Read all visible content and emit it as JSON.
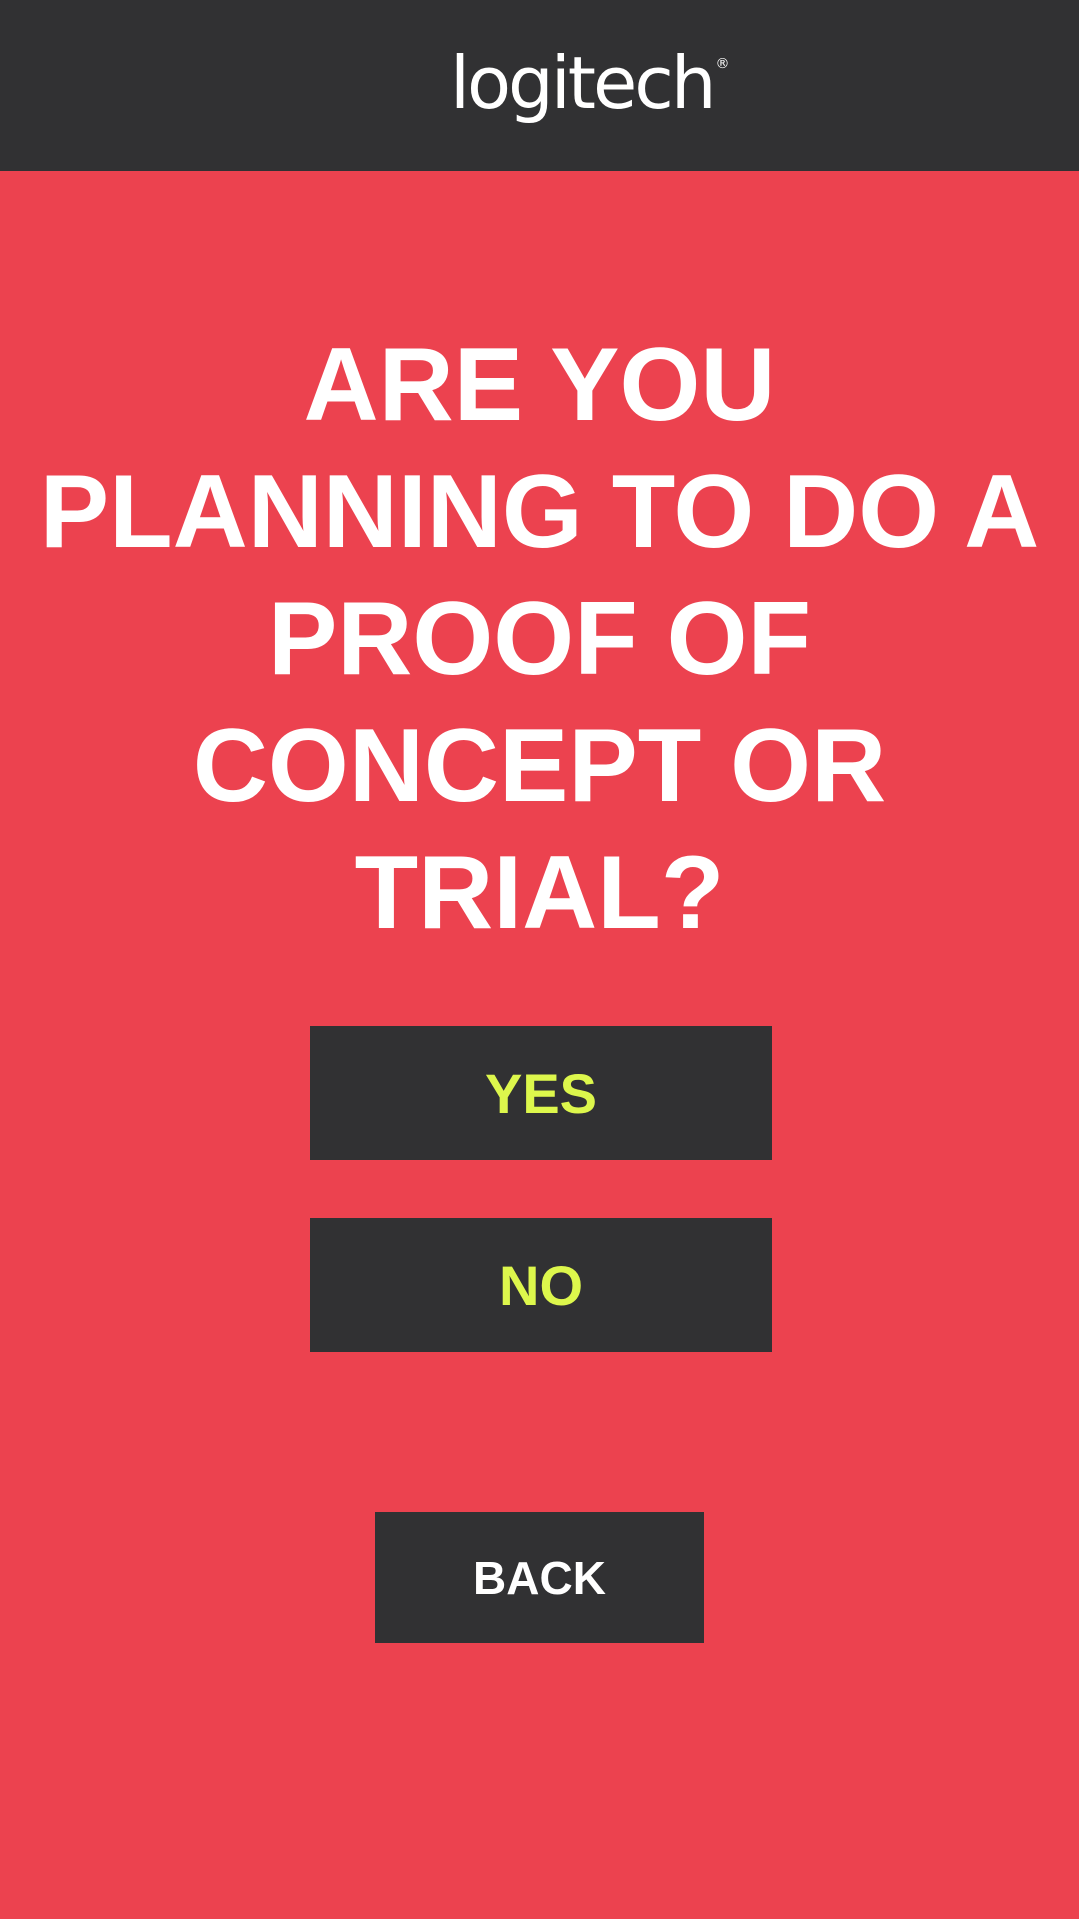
{
  "header": {
    "logo_text": "logitech",
    "logo_mark": "®"
  },
  "question": {
    "text": "ARE YOU PLANNING TO DO A PROOF OF CONCEPT OR TRIAL?"
  },
  "buttons": {
    "yes_label": "YES",
    "no_label": "NO",
    "back_label": "BACK"
  },
  "colors": {
    "background": "#EC424F",
    "header_bg": "#313133",
    "button_bg": "#313133",
    "accent_text": "#DDF74C",
    "text": "#FFFFFF"
  }
}
